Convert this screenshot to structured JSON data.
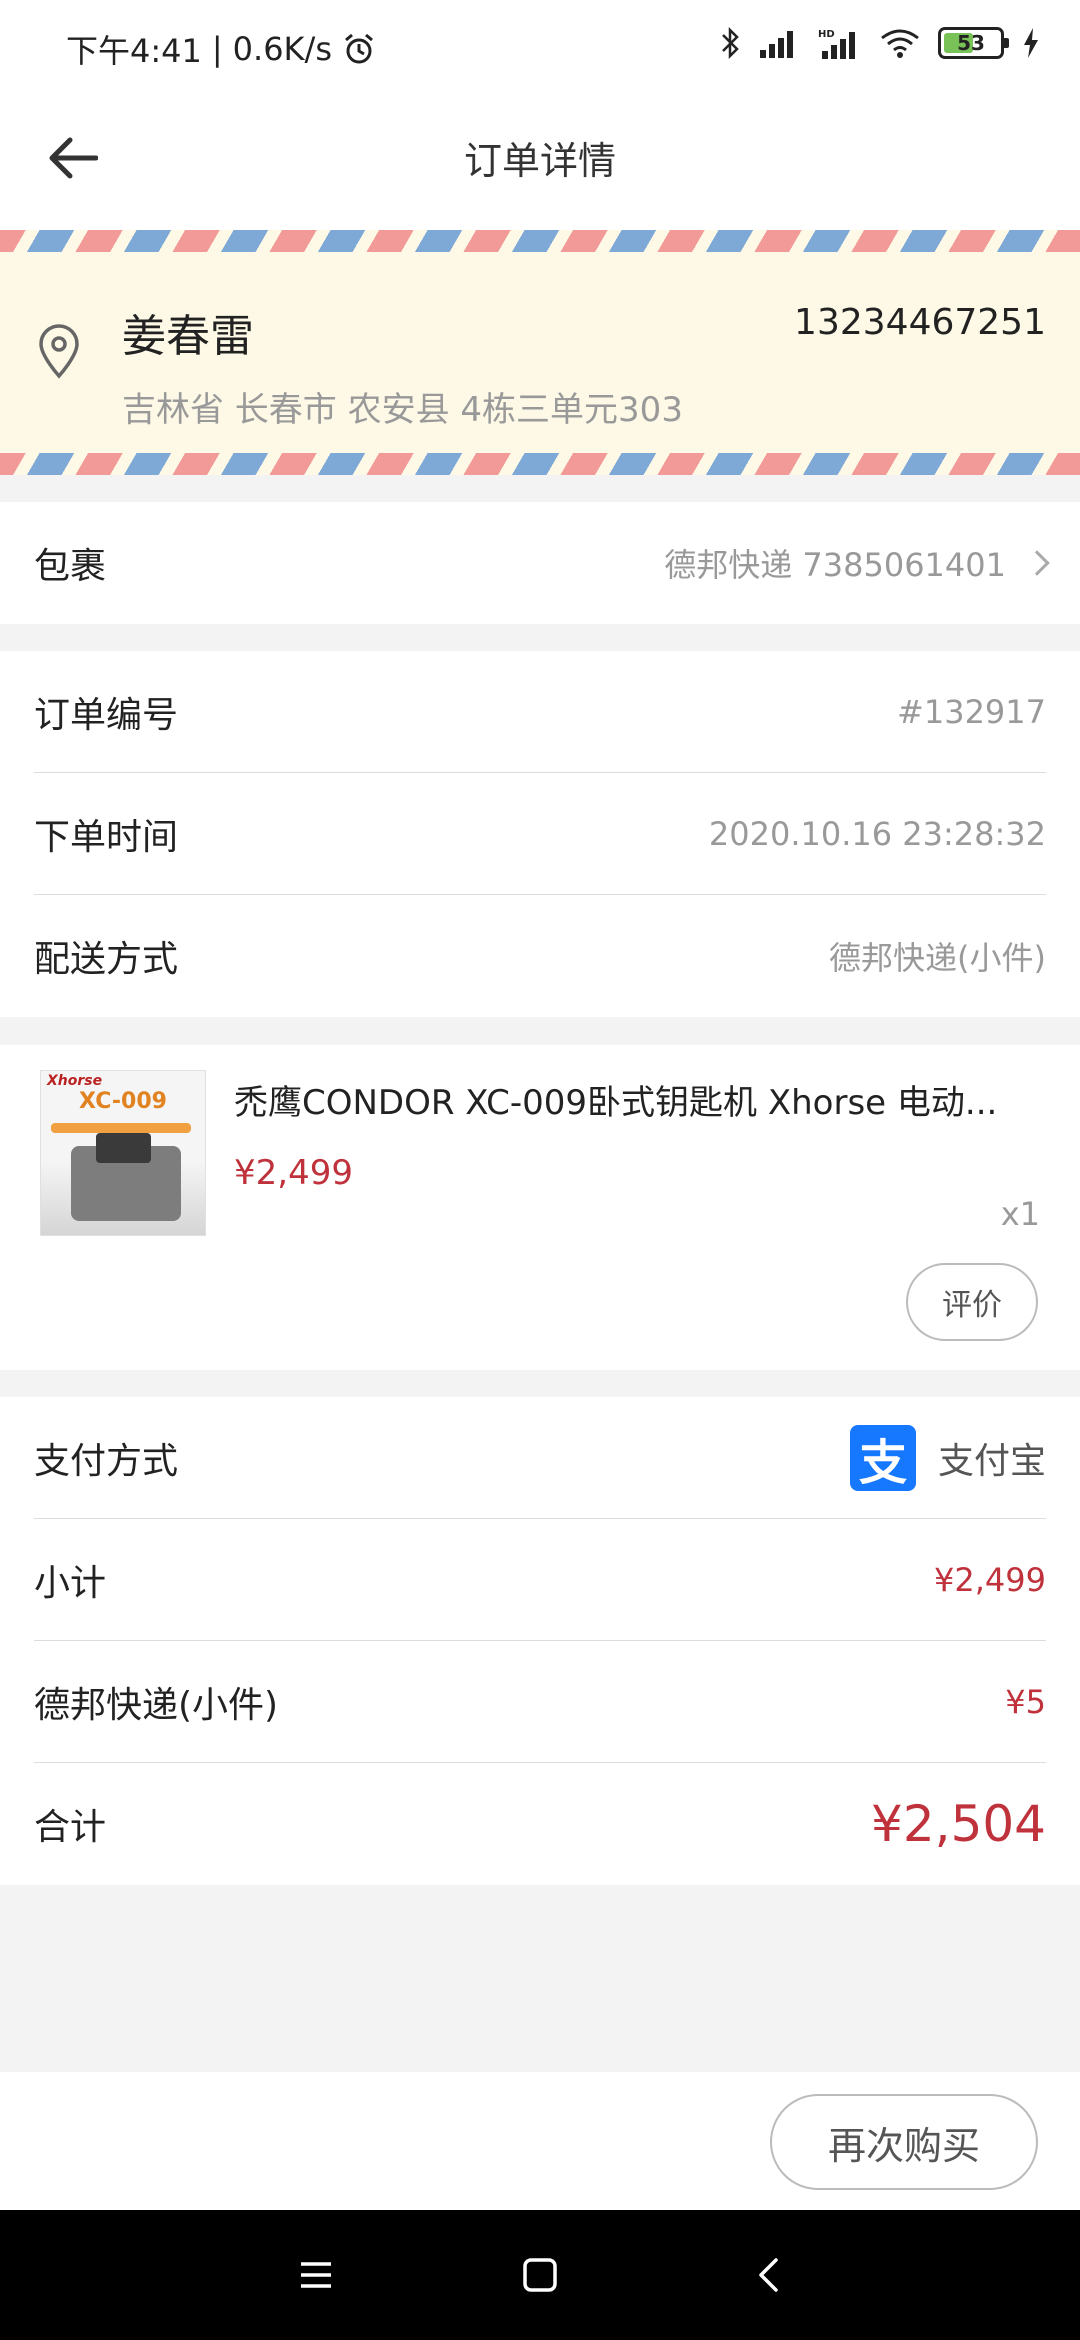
{
  "status_bar": {
    "time": "下午4:41",
    "speed": "0.6K/s",
    "battery": "53",
    "icons": [
      "alarm-icon",
      "bluetooth-icon",
      "signal-icon",
      "hd-signal-icon",
      "wifi-icon",
      "battery-icon",
      "charging-icon"
    ]
  },
  "header": {
    "title": "订单详情",
    "back_icon": "back-arrow-icon"
  },
  "address": {
    "name": "姜春雷",
    "phone": "13234467251",
    "line": "吉林省 长春市 农安县 4栋三单元303",
    "icon": "location-pin-icon",
    "stripe_colors": [
      "#f29a97",
      "#7ea9d6"
    ]
  },
  "package": {
    "label": "包裹",
    "value": "德邦快递 7385061401"
  },
  "order": {
    "number_label": "订单编号",
    "number_value": "#132917",
    "time_label": "下单时间",
    "time_value": "2020.10.16 23:28:32",
    "shipping_label": "配送方式",
    "shipping_value": "德邦快递(小件)"
  },
  "product": {
    "image_brand": "Xhorse",
    "image_model": "XC-009",
    "title": "禿鹰CONDOR XC-009卧式钥匙机 Xhorse 电动...",
    "price": "¥2,499",
    "qty": "x1",
    "review_label": "评价"
  },
  "payment": {
    "method_label": "支付方式",
    "method_name": "支付宝",
    "logo_char": "支",
    "subtotal_label": "小计",
    "subtotal_value": "¥2,499",
    "shipping_fee_label": "德邦快递(小件)",
    "shipping_fee_value": "¥5",
    "total_label": "合计",
    "total_value": "¥2,504"
  },
  "actions": {
    "rebuy_label": "再次购买"
  },
  "colors": {
    "price_red": "#c0323b",
    "alipay_blue": "#1678ff",
    "address_bg": "#fdf9e6"
  },
  "nav": {
    "icons": [
      "menu-icon",
      "home-icon",
      "back-icon"
    ]
  }
}
